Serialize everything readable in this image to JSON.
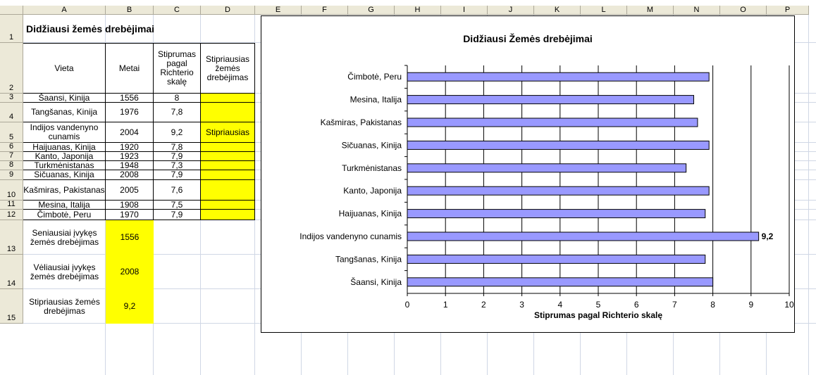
{
  "columns": [
    "A",
    "B",
    "C",
    "D",
    "E",
    "F",
    "G",
    "H",
    "I",
    "J",
    "K",
    "L",
    "M",
    "N",
    "O",
    "P"
  ],
  "rows": [
    "1",
    "2",
    "3",
    "4",
    "5",
    "6",
    "7",
    "8",
    "9",
    "10",
    "11",
    "12",
    "13",
    "14",
    "15"
  ],
  "sheet_title": "Didžiausi žemės drebėjimai",
  "headers": {
    "vieta": "Vieta",
    "metai": "Metai",
    "stiprumas": "Stiprumas pagal Richterio skalę",
    "stipriausias": "Stipriausias žemės drebėjimas"
  },
  "table": [
    {
      "vieta": "Šaansi, Kinija",
      "metai": "1556",
      "stiprumas": "8",
      "stipriausias": ""
    },
    {
      "vieta": "Tangšanas, Kinija",
      "metai": "1976",
      "stiprumas": "7,8",
      "stipriausias": ""
    },
    {
      "vieta": "Indijos vandenyno cunamis",
      "metai": "2004",
      "stiprumas": "9,2",
      "stipriausias": "Stipriausias"
    },
    {
      "vieta": "Haijuanas, Kinija",
      "metai": "1920",
      "stiprumas": "7,8",
      "stipriausias": ""
    },
    {
      "vieta": "Kanto, Japonija",
      "metai": "1923",
      "stiprumas": "7,9",
      "stipriausias": ""
    },
    {
      "vieta": "Turkmėnistanas",
      "metai": "1948",
      "stiprumas": "7,3",
      "stipriausias": ""
    },
    {
      "vieta": "Sičuanas, Kinija",
      "metai": "2008",
      "stiprumas": "7,9",
      "stipriausias": ""
    },
    {
      "vieta": "Kašmiras, Pakistanas",
      "metai": "2005",
      "stiprumas": "7,6",
      "stipriausias": ""
    },
    {
      "vieta": "Mesina, Italija",
      "metai": "1908",
      "stiprumas": "7,5",
      "stipriausias": ""
    },
    {
      "vieta": "Čimbotė, Peru",
      "metai": "1970",
      "stiprumas": "7,9",
      "stipriausias": ""
    }
  ],
  "summary": [
    {
      "label": "Seniausiai įvykęs žemės drebėjimas",
      "value": "1556"
    },
    {
      "label": "Vėliausiai įvykęs žemės drebėjimas",
      "value": "2008"
    },
    {
      "label": "Stipriausias žemės drebėjimas",
      "value": "9,2"
    }
  ],
  "colors": {
    "highlight": "#ffff00",
    "bar_fill": "#9999ff",
    "bar_border": "#000000",
    "header_bg": "#ece9d8"
  },
  "chart_data": {
    "type": "bar",
    "orientation": "horizontal",
    "title": "Didžiausi Žemės drebėjimai",
    "xlabel": "Stiprumas pagal Richterio skalę",
    "categories": [
      "Čimbotė, Peru",
      "Mesina, Italija",
      "Kašmiras, Pakistanas",
      "Sičuanas, Kinija",
      "Turkmėnistanas",
      "Kanto, Japonija",
      "Haijuanas, Kinija",
      "Indijos vandenyno cunamis",
      "Tangšanas, Kinija",
      "Šaansi, Kinija"
    ],
    "values": [
      7.9,
      7.5,
      7.6,
      7.9,
      7.3,
      7.9,
      7.8,
      9.2,
      7.8,
      8
    ],
    "data_labels": {
      "Indijos vandenyno cunamis": "9,2"
    },
    "xlim": [
      0,
      10
    ],
    "xticks": [
      "0",
      "1",
      "2",
      "3",
      "4",
      "5",
      "6",
      "7",
      "8",
      "9",
      "10"
    ],
    "grid": true,
    "legend": "none"
  }
}
